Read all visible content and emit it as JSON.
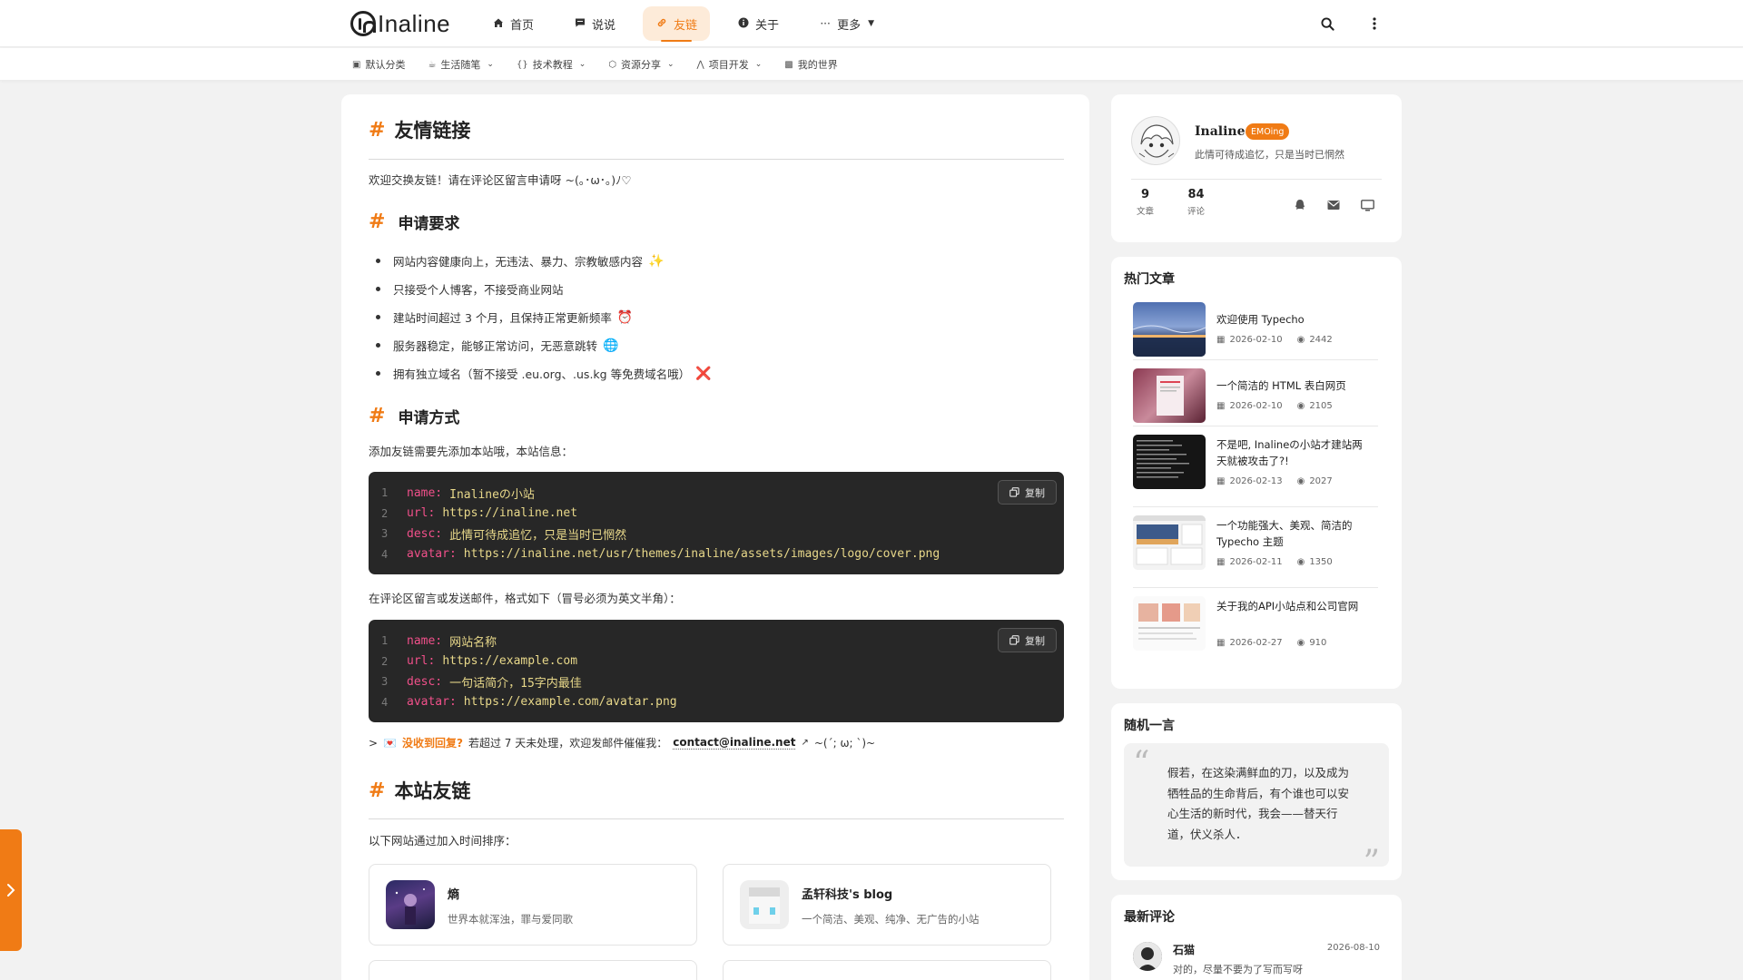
{
  "header": {
    "logo_text": "Inaline",
    "nav": [
      {
        "label": "首页",
        "icon": "home-icon"
      },
      {
        "label": "说说",
        "icon": "chat-icon"
      },
      {
        "label": "友链",
        "icon": "link-icon",
        "active": true
      },
      {
        "label": "关于",
        "icon": "info-icon"
      },
      {
        "label": "更多",
        "icon": "more-icon"
      }
    ],
    "tools": [
      "search-icon",
      "more-vertical-icon"
    ]
  },
  "categories": [
    {
      "label": "默认分类",
      "icon": "folder-icon",
      "has_menu": false
    },
    {
      "label": "生活随笔",
      "icon": "coffee-icon",
      "has_menu": true
    },
    {
      "label": "技术教程",
      "icon": "code-icon",
      "has_menu": true
    },
    {
      "label": "资源分享",
      "icon": "box-icon",
      "has_menu": true
    },
    {
      "label": "项目开发",
      "icon": "pen-icon",
      "has_menu": true
    },
    {
      "label": "我的世界",
      "icon": "cube-icon",
      "has_menu": false
    }
  ],
  "article": {
    "title": "友情链接",
    "hash": "#",
    "intro": "欢迎交换友链！请在评论区留言申请呀 ~(｡･ω･｡)ﾉ♡",
    "requirements_title": "申请要求",
    "requirements": [
      {
        "text": "网站内容健康向上，无违法、暴力、宗教敏感内容",
        "emoji": "✨"
      },
      {
        "text": "只接受个人博客，不接受商业网站",
        "emoji": ""
      },
      {
        "text": "建站时间超过 3 个月，且保持正常更新频率",
        "emoji": "⏰"
      },
      {
        "text": "服务器稳定，能够正常访问，无恶意跳转",
        "emoji": "🌐"
      },
      {
        "text": "拥有独立域名（暂不接受 .eu.org、.us.kg 等免费域名哦）",
        "emoji": "❌"
      }
    ],
    "method_title": "申请方式",
    "method_intro": "添加友链需要先添加本站哦，本站信息：",
    "copy_label": "复制",
    "site_info_code": [
      {
        "n": "1",
        "key": "name:",
        "value": "Inalineの小站"
      },
      {
        "n": "2",
        "key": "url:",
        "value": "https://inaline.net"
      },
      {
        "n": "3",
        "key": "desc:",
        "value": "此情可待成追忆，只是当时已惘然"
      },
      {
        "n": "4",
        "key": "avatar:",
        "value": "https://inaline.net/usr/themes/inaline/assets/images/logo/cover.png"
      }
    ],
    "format_intro": "在评论区留言或发送邮件，格式如下（冒号必须为英文半角）：",
    "format_code": [
      {
        "n": "1",
        "key": "name:",
        "value": "网站名称"
      },
      {
        "n": "2",
        "key": "url:",
        "value": "https://example.com"
      },
      {
        "n": "3",
        "key": "desc:",
        "value": "一句话简介，15字内最佳"
      },
      {
        "n": "4",
        "key": "avatar:",
        "value": "https://example.com/avatar.png"
      }
    ],
    "quote": {
      "prefix": ">",
      "emoji": "💌",
      "title": "没收到回复?",
      "text": "若超过 7 天未处理，欢迎发邮件催催我：",
      "email": "contact@inaline.net",
      "suffix": "~(´; ω; `)~"
    },
    "friends_title": "本站友链",
    "friends_intro": "以下网站通过加入时间排序：",
    "friends": [
      {
        "name": "熵",
        "desc": "世界本就浑浊，罪与爱同歌"
      },
      {
        "name": "孟轩科技's blog",
        "desc": "一个简洁、美观、纯净、无广告的小站"
      }
    ]
  },
  "profile": {
    "name": "Inaline",
    "badge": "EMOing",
    "desc": "此情可待成追忆，只是当时已惘然",
    "stats": [
      {
        "num": "9",
        "label": "文章"
      },
      {
        "num": "84",
        "label": "评论"
      }
    ],
    "contacts": [
      "qq-icon",
      "mail-icon",
      "monitor-icon"
    ]
  },
  "hot_posts": {
    "title": "热门文章",
    "items": [
      {
        "title": "欢迎使用 Typecho",
        "date": "2026-02-10",
        "views": "2442"
      },
      {
        "title": "一个简洁的 HTML 表白网页",
        "date": "2026-02-10",
        "views": "2105"
      },
      {
        "title": "不是吧, Inalineの小站才建站两天就被攻击了?!",
        "date": "2026-02-13",
        "views": "2027"
      },
      {
        "title": "一个功能强大、美观、简洁的 Typecho 主题",
        "date": "2026-02-11",
        "views": "1350"
      },
      {
        "title": "关于我的API小站点和公司官网",
        "date": "2026-02-27",
        "views": "910"
      }
    ]
  },
  "random_quote": {
    "title": "随机一言",
    "text": "假若，在这染满鲜血的刀，以及成为牺牲品的生命背后，有个谁也可以安心生活的新时代，我会——替天行道，伏义杀人．"
  },
  "latest_comments": {
    "title": "最新评论",
    "items": [
      {
        "name": "石猫",
        "date": "2026-08-10",
        "text": "对的，尽量不要为了写而写呀"
      }
    ]
  },
  "colors": {
    "accent": "#f07b15",
    "code_bg": "#272727",
    "code_key": "#f0508a",
    "code_value": "#e8d88a"
  }
}
